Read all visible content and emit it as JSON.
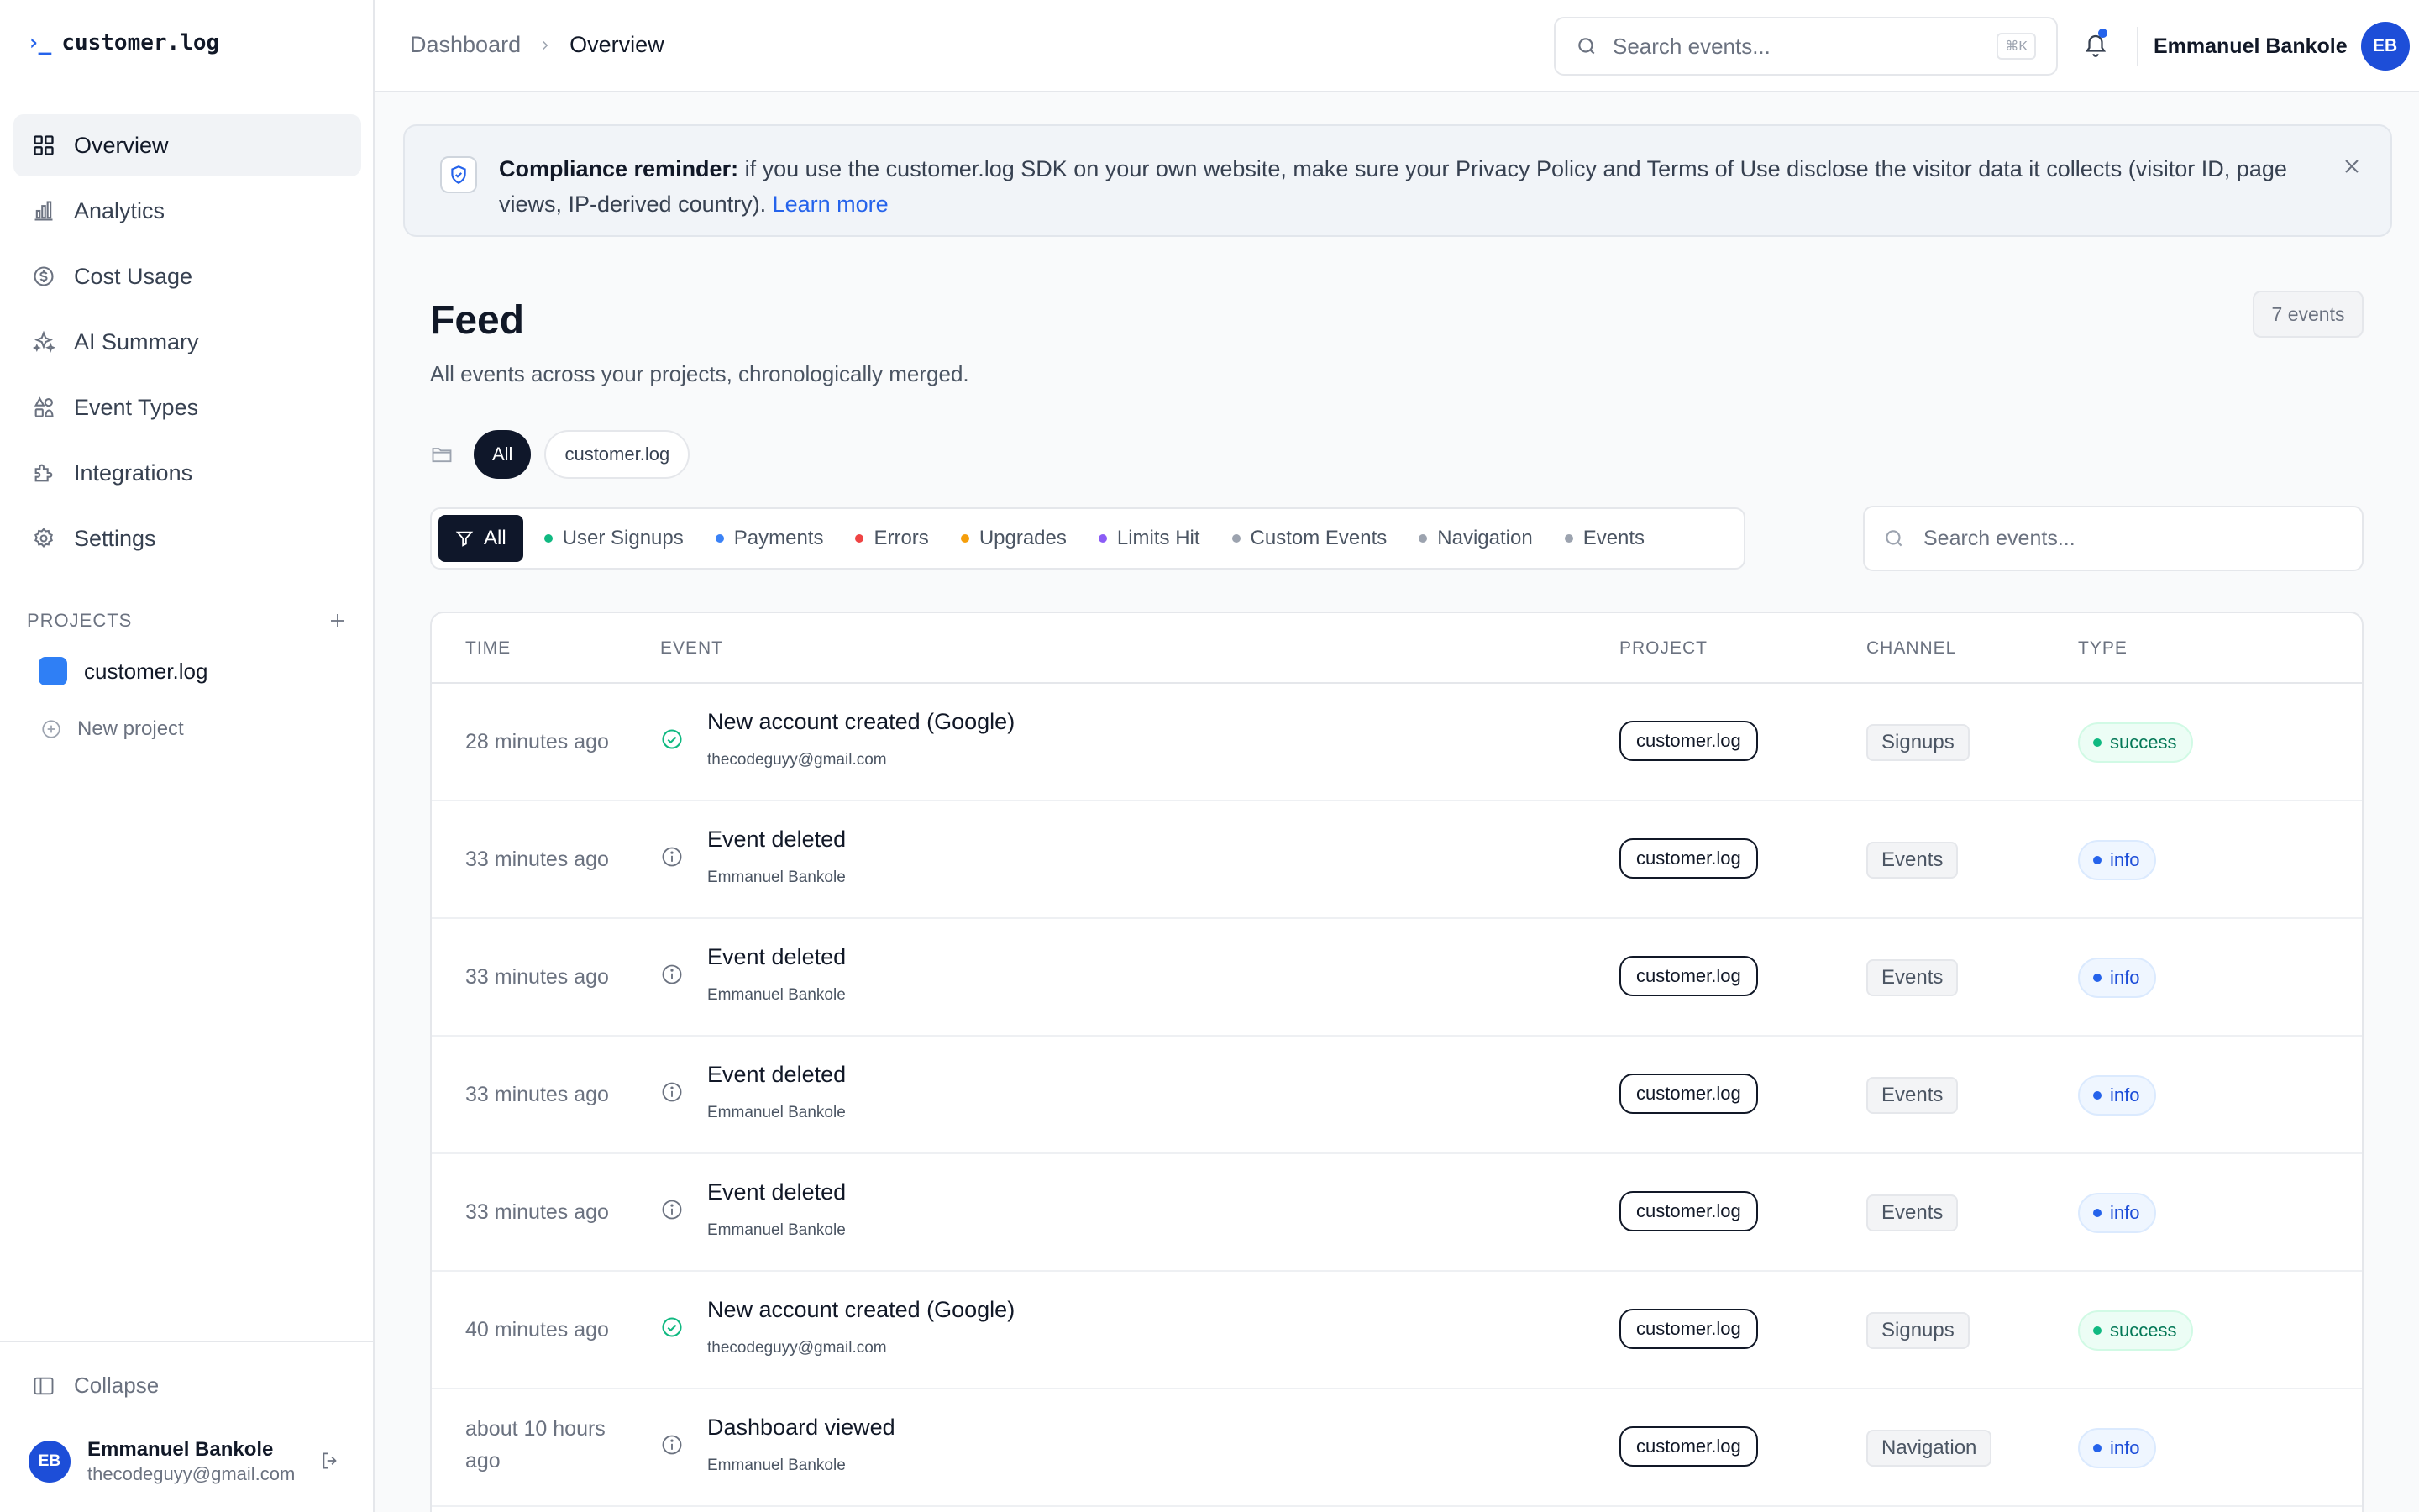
{
  "app": {
    "logo_mark": "›_",
    "logo_text": "customer.log"
  },
  "sidebar": {
    "items": [
      {
        "label": "Overview",
        "icon": "grid-icon",
        "active": true
      },
      {
        "label": "Analytics",
        "icon": "bar-chart-icon"
      },
      {
        "label": "Cost Usage",
        "icon": "dollar-circle-icon"
      },
      {
        "label": "AI Summary",
        "icon": "sparkle-icon"
      },
      {
        "label": "Event Types",
        "icon": "shapes-icon"
      },
      {
        "label": "Integrations",
        "icon": "puzzle-icon"
      },
      {
        "label": "Settings",
        "icon": "gear-icon"
      }
    ],
    "projects_heading": "PROJECTS",
    "project_name": "customer.log",
    "new_project_label": "New project",
    "collapse_label": "Collapse",
    "user": {
      "initials": "EB",
      "name": "Emmanuel Bankole",
      "email": "thecodeguyy@gmail.com"
    }
  },
  "topbar": {
    "breadcrumb": [
      "Dashboard",
      "Overview"
    ],
    "search_placeholder": "Search events...",
    "search_shortcut": "⌘K",
    "user_name": "Emmanuel Bankole",
    "user_initials": "EB"
  },
  "banner": {
    "title": "Compliance reminder:",
    "text": " if you use the customer.log SDK on your own website, make sure your Privacy Policy and Terms of Use disclose the visitor data it collects (visitor ID, page views, IP-derived country). ",
    "link": "Learn more"
  },
  "feed": {
    "title": "Feed",
    "subtitle": "All events across your projects, chronologically merged.",
    "count": "7 events",
    "project_filters": [
      "All",
      "customer.log"
    ],
    "type_filters": [
      {
        "label": "All",
        "color": "#ffffff"
      },
      {
        "label": "User Signups",
        "color": "#10b981"
      },
      {
        "label": "Payments",
        "color": "#3b82f6"
      },
      {
        "label": "Errors",
        "color": "#ef4444"
      },
      {
        "label": "Upgrades",
        "color": "#f59e0b"
      },
      {
        "label": "Limits Hit",
        "color": "#8b5cf6"
      },
      {
        "label": "Custom Events",
        "color": "#9ca3af"
      },
      {
        "label": "Navigation",
        "color": "#9ca3af"
      },
      {
        "label": "Events",
        "color": "#9ca3af"
      }
    ],
    "search_placeholder": "Search events..."
  },
  "table": {
    "columns": [
      "TIME",
      "EVENT",
      "PROJECT",
      "CHANNEL",
      "TYPE"
    ],
    "rows": [
      {
        "time": "28 minutes ago",
        "icon": "check-circle-icon",
        "title": "New account created (Google)",
        "sub": "thecodeguyy@gmail.com",
        "project": "customer.log",
        "channel": "Signups",
        "type": "success"
      },
      {
        "time": "33 minutes ago",
        "icon": "info-circle-icon",
        "title": "Event deleted",
        "sub": "Emmanuel Bankole",
        "project": "customer.log",
        "channel": "Events",
        "type": "info"
      },
      {
        "time": "33 minutes ago",
        "icon": "info-circle-icon",
        "title": "Event deleted",
        "sub": "Emmanuel Bankole",
        "project": "customer.log",
        "channel": "Events",
        "type": "info"
      },
      {
        "time": "33 minutes ago",
        "icon": "info-circle-icon",
        "title": "Event deleted",
        "sub": "Emmanuel Bankole",
        "project": "customer.log",
        "channel": "Events",
        "type": "info"
      },
      {
        "time": "33 minutes ago",
        "icon": "info-circle-icon",
        "title": "Event deleted",
        "sub": "Emmanuel Bankole",
        "project": "customer.log",
        "channel": "Events",
        "type": "info"
      },
      {
        "time": "40 minutes ago",
        "icon": "check-circle-icon",
        "title": "New account created (Google)",
        "sub": "thecodeguyy@gmail.com",
        "project": "customer.log",
        "channel": "Signups",
        "type": "success"
      },
      {
        "time": "about 10 hours ago",
        "icon": "info-circle-icon",
        "title": "Dashboard viewed",
        "sub": "Emmanuel Bankole",
        "project": "customer.log",
        "channel": "Navigation",
        "type": "info"
      }
    ]
  },
  "colors": {
    "accent": "#2563eb",
    "dark": "#0f172a",
    "success": "#047857",
    "info": "#1d4ed8"
  }
}
